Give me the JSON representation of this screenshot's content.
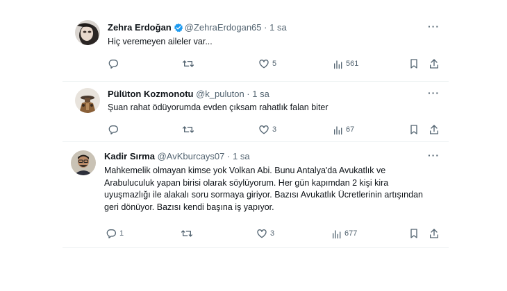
{
  "tweets": [
    {
      "name": "Zehra Erdoğan",
      "handle": "@ZehraErdogan65",
      "time": "· 1 sa",
      "verified": true,
      "text": "Hiç veremeyen aileler var...",
      "replies": "",
      "likes": "5",
      "views": "561"
    },
    {
      "name": "Pülüton Kozmonotu",
      "handle": "@k_puluton",
      "time": "· 1 sa",
      "verified": false,
      "text": "Şuan rahat ödüyorumda evden çıksam rahatlık falan biter",
      "replies": "",
      "likes": "3",
      "views": "67"
    },
    {
      "name": "Kadir Sırma",
      "handle": "@AvKburcays07",
      "time": "· 1 sa",
      "verified": false,
      "text": "Mahkemelik olmayan kimse yok Volkan Abi. Bunu Antalya'da Avukatlık ve Arabuluculuk yapan birisi olarak söylüyorum. Her gün kapımdan 2 kişi kira uyuşmazlığı ile alakalı soru sormaya giriyor. Bazısı Avukatlık Ücretlerinin artışından geri dönüyor. Bazısı kendi başına iş yapıyor.",
      "replies": "1",
      "likes": "3",
      "views": "677"
    }
  ],
  "icons": {
    "reply": "reply-icon",
    "retweet": "retweet-icon",
    "like": "heart-icon",
    "views": "views-icon",
    "bookmark": "bookmark-icon",
    "share": "share-icon",
    "more": "more-icon",
    "verified": "verified-badge-icon"
  },
  "colors": {
    "verified": "#1d9bf0",
    "text": "#0f1419",
    "muted": "#536471"
  }
}
